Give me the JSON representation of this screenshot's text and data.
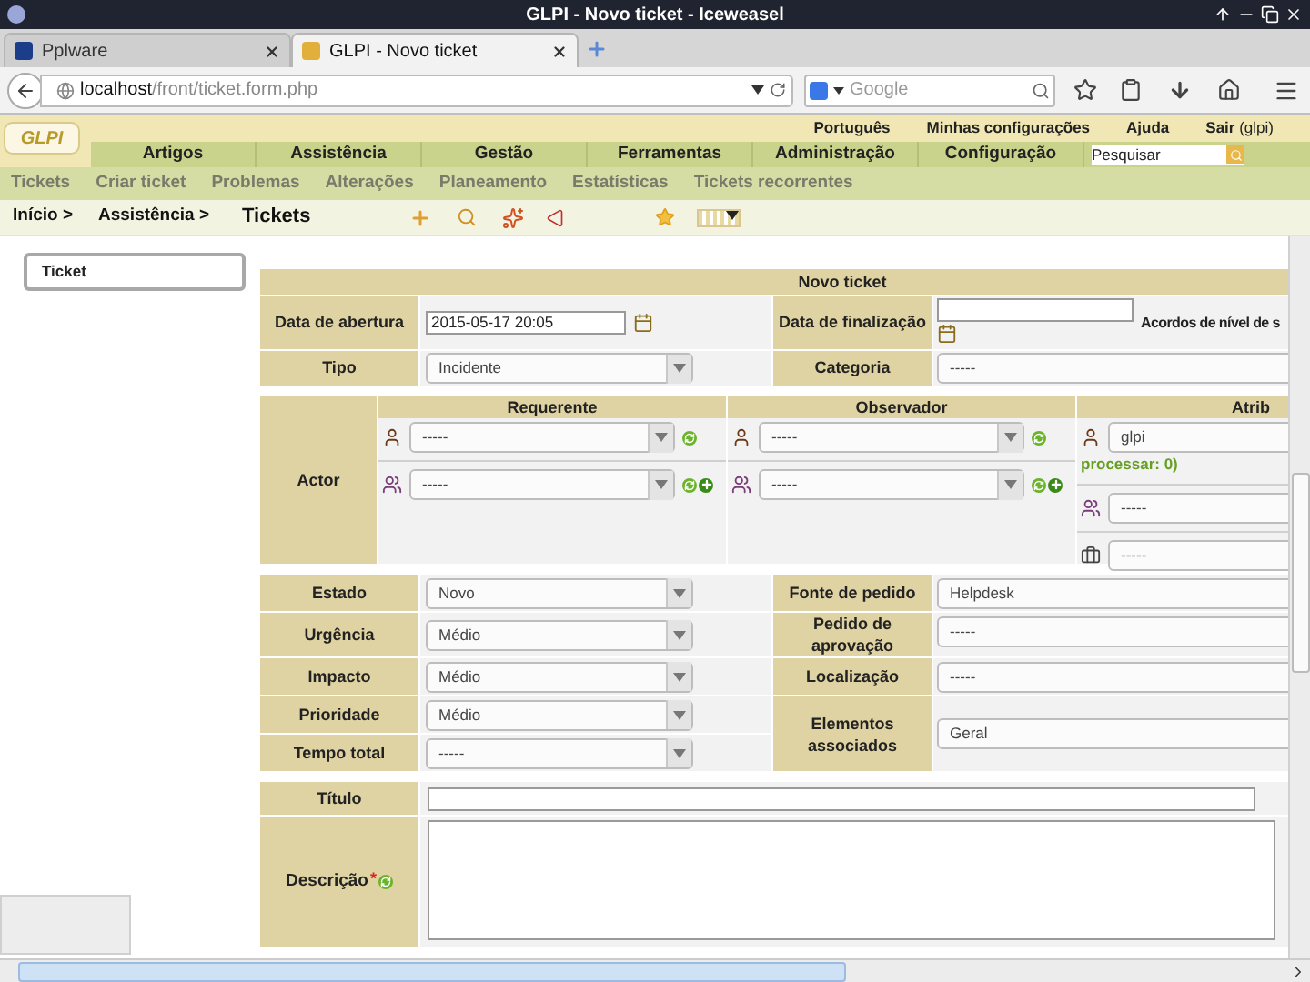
{
  "window": {
    "title": "GLPI - Novo ticket - Iceweasel"
  },
  "tabs": [
    {
      "label": "Pplware",
      "selected": false
    },
    {
      "label": "GLPI - Novo ticket",
      "selected": true
    }
  ],
  "address_bar": {
    "host": "localhost",
    "path": "/front/ticket.form.php"
  },
  "web_search": {
    "placeholder": "Google"
  },
  "glpi": {
    "logo": "GLPI",
    "top_links": [
      "Português",
      "Minhas configurações",
      "Ajuda"
    ],
    "logout": "**Sair** (glpi)",
    "main_menu": [
      "Artigos",
      "Assistência",
      "Gestão",
      "Ferramentas",
      "Administração",
      "Configuração"
    ],
    "search": {
      "placeholder": "Pesquisar"
    },
    "sub_menu": [
      "Tickets",
      "Criar ticket",
      "Problemas",
      "Alterações",
      "Planeamento",
      "Estatísticas",
      "Tickets recorrentes"
    ],
    "breadcrumb": [
      "Início >",
      "Assistência >"
    ],
    "page_title": "Tickets"
  },
  "sidebar": {
    "tabs": [
      {
        "label": "Ticket",
        "selected": true
      }
    ]
  },
  "form": {
    "title": "Novo ticket",
    "opening_date": {
      "label": "Data de abertura",
      "value": "2015-05-17 20:05"
    },
    "close_date": {
      "label": "Data de finalização"
    },
    "sla": {
      "label": "Acordos de nível de s"
    },
    "type": {
      "label": "Tipo",
      "value": "Incidente"
    },
    "category": {
      "label": "Categoria",
      "value": "-----"
    },
    "actor": {
      "label": "Actor",
      "columns": [
        {
          "heading": "Requerente",
          "rows": [
            {
              "kind": "user",
              "value": "-----"
            },
            {
              "kind": "group",
              "value": "-----"
            }
          ]
        },
        {
          "heading": "Observador",
          "rows": [
            {
              "kind": "user",
              "value": "-----"
            },
            {
              "kind": "group",
              "value": "-----"
            }
          ]
        },
        {
          "heading": "Atrib",
          "rows": [
            {
              "kind": "assignee",
              "value": "glpi",
              "note": "processar: 0)"
            },
            {
              "kind": "group_plain",
              "value": "-----"
            },
            {
              "kind": "supplier",
              "value": "-----"
            }
          ]
        }
      ]
    },
    "left_fields": [
      {
        "label": "Estado",
        "value": "Novo"
      },
      {
        "label": "Urgência",
        "value": "Médio"
      },
      {
        "label": "Impacto",
        "value": "Médio"
      },
      {
        "label": "Prioridade",
        "value": "Médio"
      },
      {
        "label": "Tempo total",
        "value": "-----"
      }
    ],
    "right_fields": [
      {
        "label": "Fonte de pedido",
        "value": "Helpdesk"
      },
      {
        "label": "Pedido de aprovação",
        "value": "-----"
      },
      {
        "label": "Localização",
        "value": "-----"
      },
      {
        "label": "Elementos associados",
        "value": "Geral"
      }
    ],
    "title_field": {
      "label": "Título"
    },
    "description": {
      "label": "Descrição",
      "required_mark": "*"
    }
  }
}
